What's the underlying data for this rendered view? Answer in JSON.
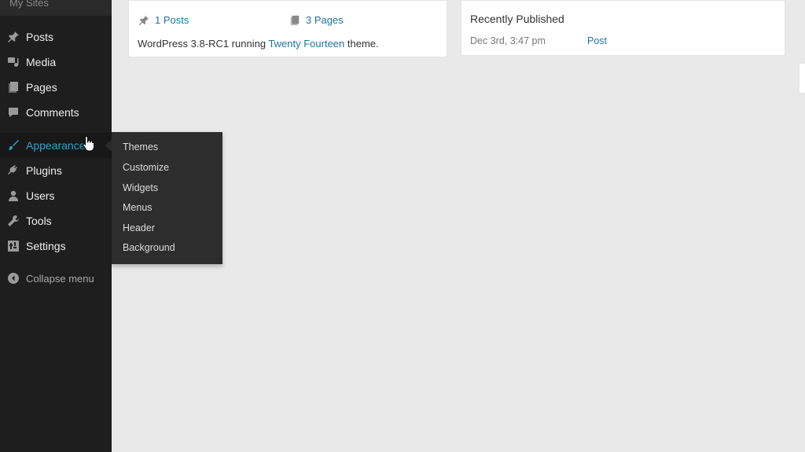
{
  "sidebar": {
    "top_item": "My Sites",
    "items": [
      {
        "label": "Posts",
        "icon": "pin-icon"
      },
      {
        "label": "Media",
        "icon": "media-icon"
      },
      {
        "label": "Pages",
        "icon": "pages-icon"
      },
      {
        "label": "Comments",
        "icon": "comment-icon"
      },
      {
        "label": "Appearance",
        "icon": "paintbrush-icon",
        "active": true
      },
      {
        "label": "Plugins",
        "icon": "plugin-icon"
      },
      {
        "label": "Users",
        "icon": "user-icon"
      },
      {
        "label": "Tools",
        "icon": "wrench-icon"
      },
      {
        "label": "Settings",
        "icon": "settings-icon"
      }
    ],
    "collapse_label": "Collapse menu"
  },
  "flyout": {
    "items": [
      "Themes",
      "Customize",
      "Widgets",
      "Menus",
      "Header",
      "Background"
    ]
  },
  "at_a_glance": {
    "posts": "1 Posts",
    "pages": "3 Pages",
    "info_prefix": "WordPress 3.8-RC1 running ",
    "theme_link": "Twenty Fourteen",
    "info_suffix": " theme."
  },
  "activity": {
    "heading": "Recently Published",
    "date": "Dec 3rd, 3:47 pm",
    "post_link": "Post"
  },
  "colors": {
    "sidebar_bg": "#1e1e1e",
    "flyout_bg": "#2d2d2d",
    "accent": "#2ea2cc",
    "link": "#21759b",
    "page_bg": "#e9e9e9"
  }
}
